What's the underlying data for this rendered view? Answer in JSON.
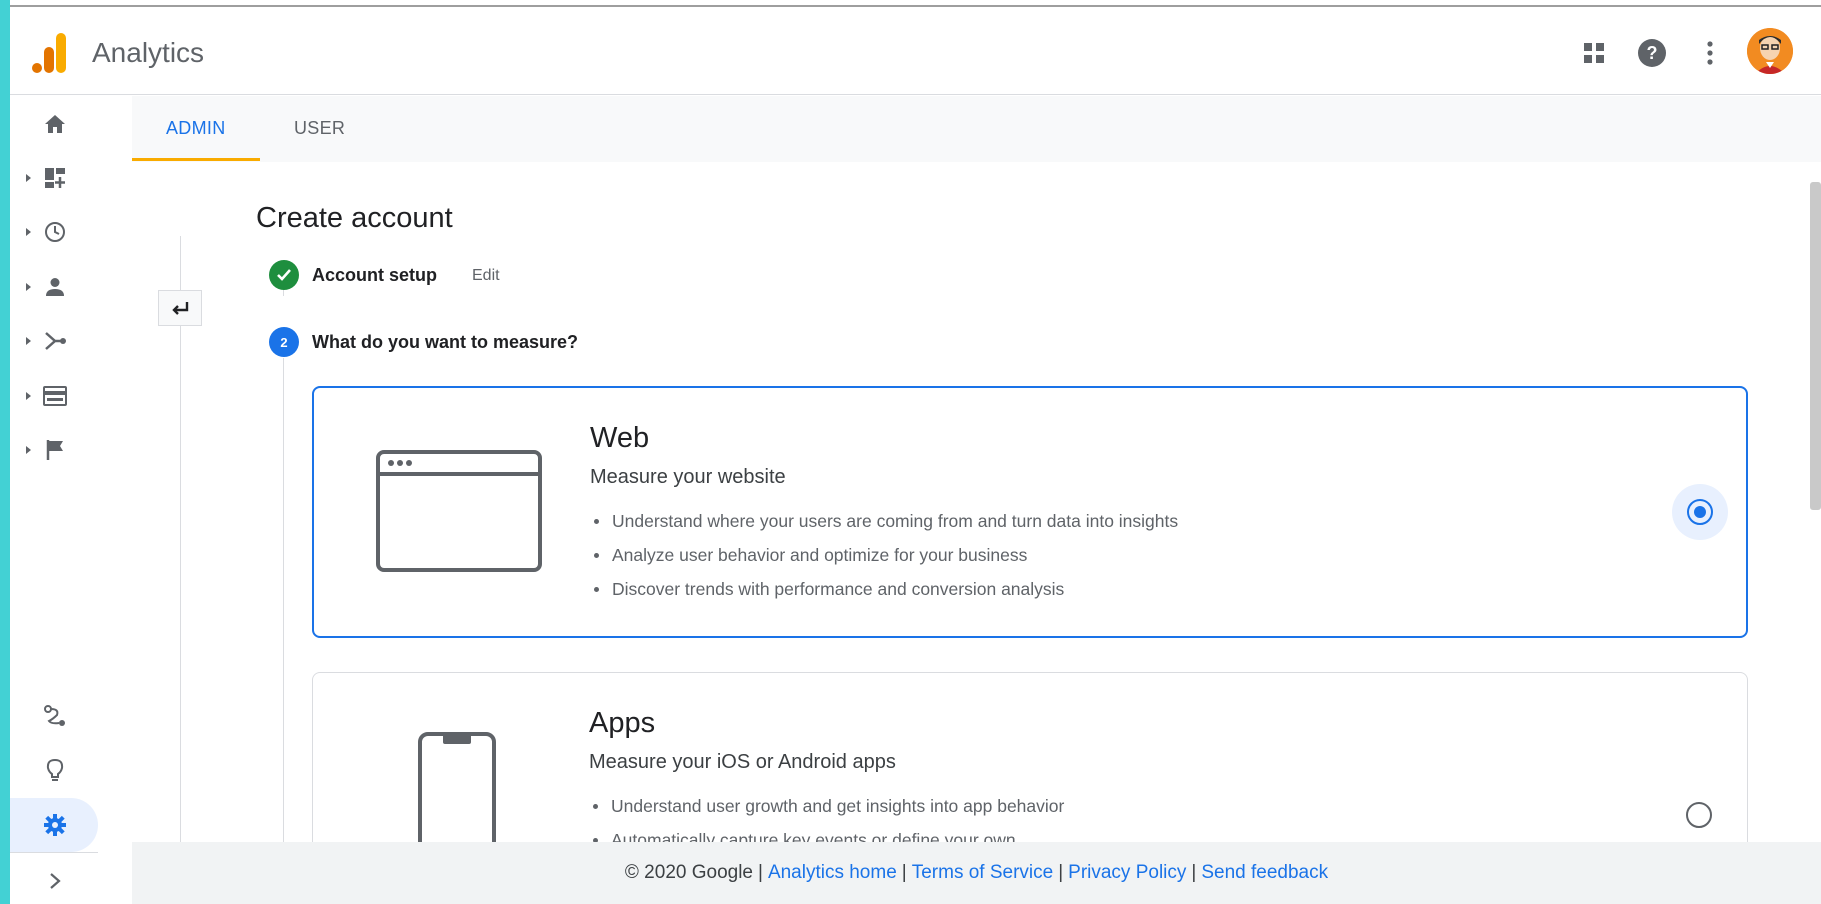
{
  "app": {
    "title": "Analytics"
  },
  "header": {
    "icons": [
      "apps-grid-icon",
      "help-icon",
      "more-vert-icon",
      "avatar"
    ]
  },
  "sidebar": {
    "items": [
      {
        "name": "home-icon",
        "has_arrow": false
      },
      {
        "name": "dashboard-icon",
        "has_arrow": true
      },
      {
        "name": "realtime-clock-icon",
        "has_arrow": true
      },
      {
        "name": "audience-person-icon",
        "has_arrow": true
      },
      {
        "name": "acquisition-icon",
        "has_arrow": true
      },
      {
        "name": "behavior-icon",
        "has_arrow": true
      },
      {
        "name": "conversions-flag-icon",
        "has_arrow": true
      }
    ],
    "bottom": [
      "attribution-icon",
      "discover-lightbulb-icon",
      "admin-gear-icon",
      "expand-chevron-icon"
    ]
  },
  "tabs": [
    {
      "label": "ADMIN",
      "active": true
    },
    {
      "label": "USER",
      "active": false
    }
  ],
  "page": {
    "title": "Create account",
    "steps": [
      {
        "number": "",
        "label": "Account setup",
        "status": "complete",
        "edit": "Edit"
      },
      {
        "number": "2",
        "label": "What do you want to measure?",
        "status": "current"
      }
    ]
  },
  "options": [
    {
      "title": "Web",
      "subtitle": "Measure your website",
      "bullets": [
        "Understand where your users are coming from and turn data into insights",
        "Analyze user behavior and optimize for your business",
        "Discover trends with performance and conversion analysis"
      ],
      "selected": true
    },
    {
      "title": "Apps",
      "subtitle": "Measure your iOS or Android apps",
      "bullets": [
        "Understand user growth and get insights into app behavior",
        "Automatically capture key events or define your own"
      ],
      "selected": false
    }
  ],
  "footer": {
    "copyright": "© 2020 Google",
    "links": [
      "Analytics home",
      "Terms of Service",
      "Privacy Policy",
      "Send feedback"
    ],
    "separator": "|"
  },
  "colors": {
    "accent": "#1a73e8",
    "tab_underline": "#f9ab00",
    "step_complete": "#1e8e3e",
    "left_stripe": "#43d1d4"
  }
}
